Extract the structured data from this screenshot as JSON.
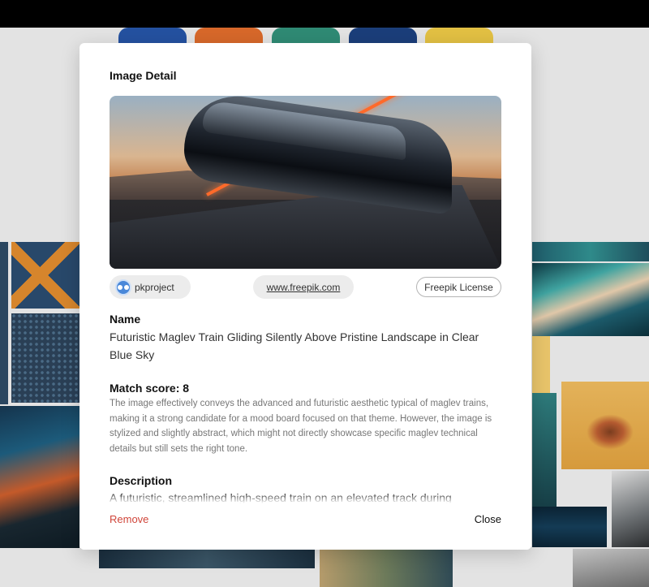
{
  "background": {
    "tab_colors": [
      "#2451a0",
      "#d7682a",
      "#2f8a74",
      "#1b3e7a",
      "#e2c043"
    ]
  },
  "modal": {
    "title": "Image Detail",
    "image": {
      "alt": "Futuristic maglev train on elevated track"
    },
    "author": {
      "name": "pkproject",
      "avatar_icon": "blue-face-avatar"
    },
    "source_link": "www.freepik.com",
    "license_label": "Freepik License",
    "name_heading": "Name",
    "name_value": "Futuristic Maglev Train Gliding Silently Above Pristine Landscape in Clear Blue Sky",
    "match_heading": "Match score: 8",
    "match_text": "The image effectively conveys the advanced and futuristic aesthetic typical of maglev trains, making it a strong candidate for a mood board focused on that theme. However, the image is stylized and slightly abstract, which might not directly showcase specific maglev technical details but still sets the right tone.",
    "description_heading": "Description",
    "description_text": "A futuristic, streamlined high-speed train on an elevated track during",
    "remove_label": "Remove",
    "close_label": "Close"
  }
}
